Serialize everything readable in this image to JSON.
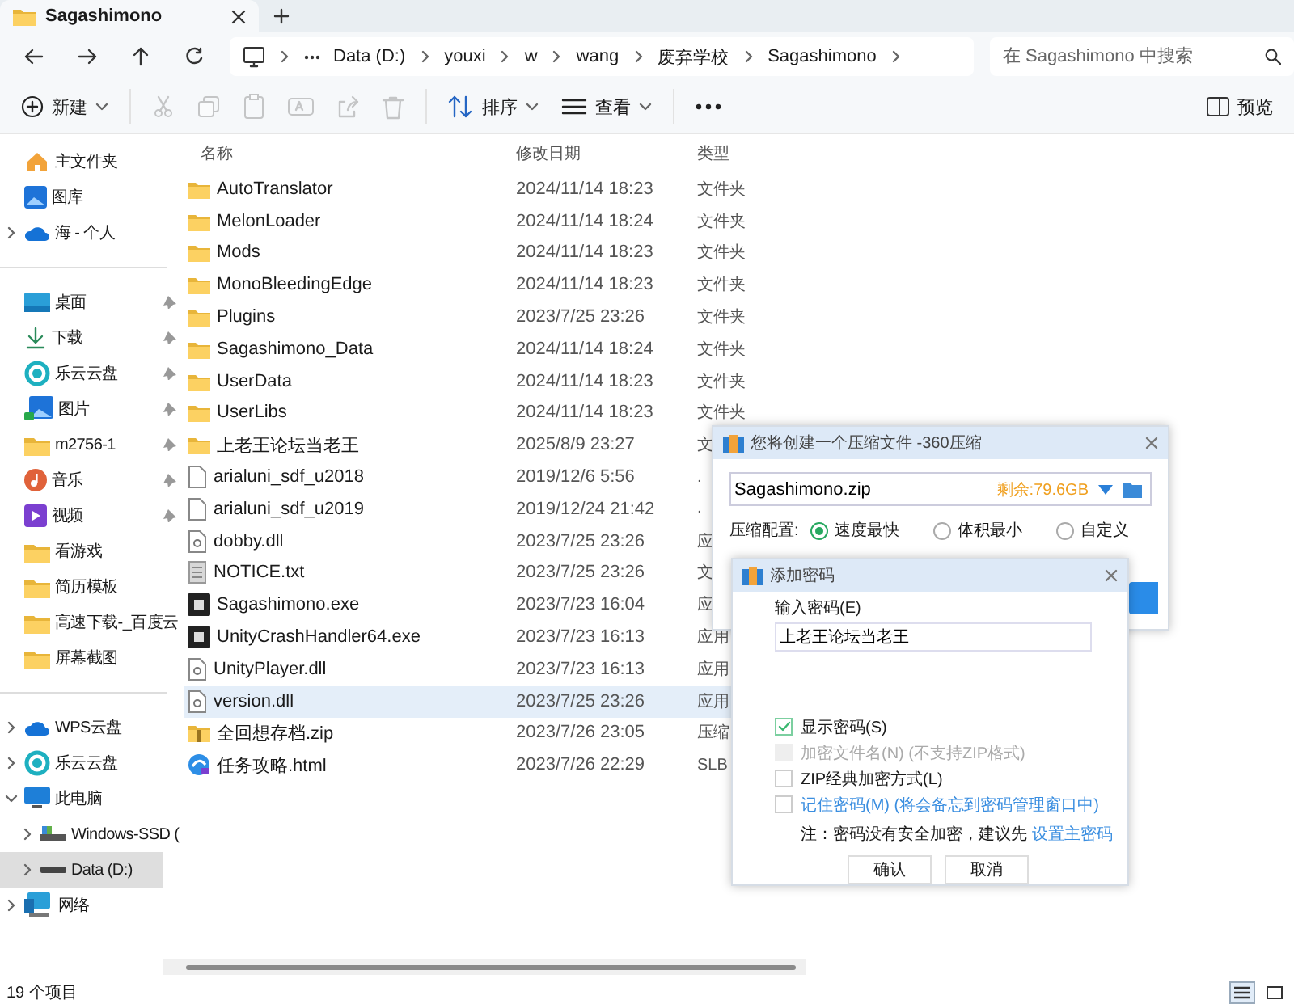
{
  "tab": {
    "title": "Sagashimono",
    "selected": true
  },
  "breadcrumb": [
    "Data (D:)",
    "youxi",
    "w",
    "wang",
    "废弃学校",
    "Sagashimono"
  ],
  "search": {
    "placeholder": "在 Sagashimono 中搜索"
  },
  "toolbar": [
    {
      "kind": "new",
      "label": "新建",
      "disabled": false
    },
    {
      "kind": "cut",
      "disabled": true
    },
    {
      "kind": "copy",
      "disabled": true
    },
    {
      "kind": "paste",
      "disabled": true
    },
    {
      "kind": "rename",
      "disabled": true
    },
    {
      "kind": "share",
      "disabled": true
    },
    {
      "kind": "delete",
      "disabled": true
    },
    {
      "kind": "sort",
      "label": "排序",
      "disabled": false
    },
    {
      "kind": "view",
      "label": "查看",
      "disabled": false
    },
    {
      "kind": "more",
      "disabled": false
    }
  ],
  "preview_button": "预览",
  "sidebar": [
    [
      {
        "label": "主文件夹",
        "kind": "home",
        "selected": false
      },
      {
        "label": "图库",
        "kind": "gallery",
        "selected": false
      },
      {
        "label": "海 - 个人",
        "kind": "cloud",
        "expanded": false,
        "selected": false
      }
    ],
    [
      {
        "label": "桌面",
        "kind": "desktop",
        "pinned": true,
        "selected": false
      },
      {
        "label": "下载",
        "kind": "download",
        "pinned": true,
        "selected": false
      },
      {
        "label": "乐云云盘",
        "kind": "lecloud",
        "pinned": true,
        "selected": false
      },
      {
        "label": "图片",
        "kind": "pictures",
        "pinned": true,
        "selected": false
      },
      {
        "label": "m2756-1",
        "kind": "folder",
        "pinned": true,
        "selected": false
      },
      {
        "label": "音乐",
        "kind": "music",
        "pinned": true,
        "selected": false
      },
      {
        "label": "视频",
        "kind": "video",
        "pinned": true,
        "selected": false
      },
      {
        "label": "看游戏",
        "kind": "folder",
        "pinned": false,
        "selected": false
      },
      {
        "label": "简历模板",
        "kind": "folder",
        "pinned": false,
        "selected": false
      },
      {
        "label": "高速下载-_百度云",
        "kind": "folder",
        "selected": false
      },
      {
        "label": "屏幕截图",
        "kind": "folder",
        "pinned": false,
        "selected": false
      }
    ],
    [
      {
        "label": "WPS云盘",
        "kind": "cloud",
        "expanded": false,
        "selected": false
      },
      {
        "label": "乐云云盘",
        "kind": "lecloud",
        "expanded": false,
        "selected": false
      },
      {
        "label": "此电脑",
        "kind": "pc",
        "expanded": true,
        "selected": false,
        "children": [
          {
            "label": "Windows-SSD (",
            "kind": "ssd",
            "expanded": false,
            "selected": false
          },
          {
            "label": "Data (D:)",
            "kind": "drive",
            "expanded": false,
            "selected": true
          }
        ]
      },
      {
        "label": "网络",
        "kind": "network",
        "expanded": false,
        "selected": false
      }
    ]
  ],
  "columns": [
    "名称",
    "修改日期",
    "类型"
  ],
  "rows": [
    {
      "name": "AutoTranslator",
      "date": "2024/11/14 18:23",
      "type": "文件夹",
      "kind": "folder",
      "selected": false
    },
    {
      "name": "MelonLoader",
      "date": "2024/11/14 18:24",
      "type": "文件夹",
      "kind": "folder",
      "selected": false
    },
    {
      "name": "Mods",
      "date": "2024/11/14 18:23",
      "type": "文件夹",
      "kind": "folder",
      "selected": false
    },
    {
      "name": "MonoBleedingEdge",
      "date": "2024/11/14 18:23",
      "type": "文件夹",
      "kind": "folder",
      "selected": false
    },
    {
      "name": "Plugins",
      "date": "2023/7/25 23:26",
      "type": "文件夹",
      "kind": "folder",
      "selected": false
    },
    {
      "name": "Sagashimono_Data",
      "date": "2024/11/14 18:24",
      "type": "文件夹",
      "kind": "folder",
      "selected": false
    },
    {
      "name": "UserData",
      "date": "2024/11/14 18:23",
      "type": "文件夹",
      "kind": "folder",
      "selected": false
    },
    {
      "name": "UserLibs",
      "date": "2024/11/14 18:23",
      "type": "文件夹",
      "kind": "folder",
      "selected": false
    },
    {
      "name": "上老王论坛当老王",
      "date": "2025/8/9 23:27",
      "type": "文",
      "kind": "folder",
      "selected": false
    },
    {
      "name": "arialuni_sdf_u2018",
      "date": "2019/12/6 5:56",
      "type": ".",
      "kind": "file",
      "selected": false
    },
    {
      "name": "arialuni_sdf_u2019",
      "date": "2019/12/24 21:42",
      "type": ".",
      "kind": "file",
      "selected": false
    },
    {
      "name": "dobby.dll",
      "date": "2023/7/25 23:26",
      "type": "应",
      "kind": "dll",
      "selected": false
    },
    {
      "name": "NOTICE.txt",
      "date": "2023/7/25 23:26",
      "type": "文",
      "kind": "txt",
      "selected": false
    },
    {
      "name": "Sagashimono.exe",
      "date": "2023/7/23 16:04",
      "type": "应",
      "kind": "exe",
      "selected": false
    },
    {
      "name": "UnityCrashHandler64.exe",
      "date": "2023/7/23 16:13",
      "type": "应用",
      "kind": "exe",
      "selected": false
    },
    {
      "name": "UnityPlayer.dll",
      "date": "2023/7/23 16:13",
      "type": "应用",
      "kind": "dll",
      "selected": false
    },
    {
      "name": "version.dll",
      "date": "2023/7/25 23:26",
      "type": "应用",
      "kind": "dll",
      "selected": true
    },
    {
      "name": "全回想存档.zip",
      "date": "2023/7/26 23:05",
      "type": "压缩",
      "kind": "zip",
      "selected": false
    },
    {
      "name": "任务攻略.html",
      "date": "2023/7/26 22:29",
      "type": "SLB",
      "kind": "html",
      "selected": false
    }
  ],
  "status_bar": {
    "count": "19 个项目"
  },
  "zip_dialog": {
    "title": "您将创建一个压缩文件 -360压缩",
    "filename": "Sagashimono.zip",
    "free_space": "剩余:79.6GB",
    "config_label": "压缩配置:",
    "options": [
      {
        "label": "速度最快",
        "selected": true
      },
      {
        "label": "体积最小",
        "selected": false
      },
      {
        "label": "自定义",
        "selected": false
      }
    ]
  },
  "password_dialog": {
    "title": "添加密码",
    "field_label": "输入密码(E)",
    "password": "上老王论坛当老王",
    "options": [
      {
        "label": "显示密码(S)",
        "checked": true,
        "disabled": false,
        "kind": "plain"
      },
      {
        "label": "加密文件名(N) (不支持ZIP格式)",
        "checked": false,
        "disabled": true,
        "kind": "plain"
      },
      {
        "label": "ZIP经典加密方式(L)",
        "checked": false,
        "disabled": false,
        "kind": "plain"
      },
      {
        "label": "记住密码(M) (将会备忘到密码管理窗口中)",
        "checked": false,
        "disabled": false,
        "kind": "link"
      }
    ],
    "note": "注：密码没有安全加密，建议先",
    "note_link": "设置主密码",
    "buttons": [
      "确认",
      "取消"
    ]
  }
}
